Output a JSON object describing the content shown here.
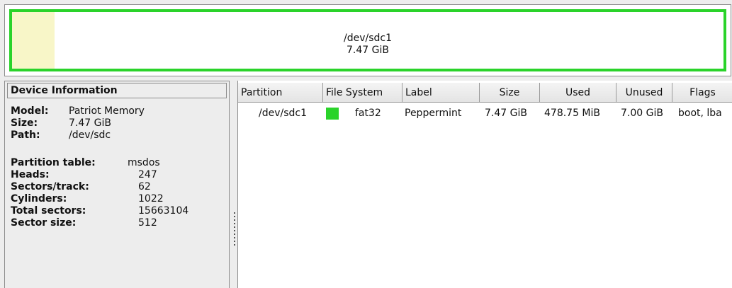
{
  "graph": {
    "partition_name": "/dev/sdc1",
    "partition_size": "7.47 GiB",
    "partition_color": "#2ad32a",
    "used_color": "#f8f6c8",
    "used_fraction": 0.06
  },
  "device_info": {
    "title": "Device Information",
    "model_label": "Model:",
    "model_value": "Patriot Memory",
    "size_label": "Size:",
    "size_value": "7.47 GiB",
    "path_label": "Path:",
    "path_value": "/dev/sdc",
    "partition_table_label": "Partition table:",
    "partition_table_value": "msdos",
    "heads_label": "Heads:",
    "heads_value": "247",
    "sectors_track_label": "Sectors/track:",
    "sectors_track_value": "62",
    "cylinders_label": "Cylinders:",
    "cylinders_value": "1022",
    "total_sectors_label": "Total sectors:",
    "total_sectors_value": "15663104",
    "sector_size_label": "Sector size:",
    "sector_size_value": "512"
  },
  "columns": [
    "Partition",
    "File System",
    "Label",
    "Size",
    "Used",
    "Unused",
    "Flags"
  ],
  "rows": [
    {
      "partition": "/dev/sdc1",
      "fs_color": "#2ad32a",
      "filesystem": "fat32",
      "label": "Peppermint",
      "size": "7.47 GiB",
      "used": "478.75 MiB",
      "unused": "7.00 GiB",
      "flags": "boot, lba"
    }
  ]
}
